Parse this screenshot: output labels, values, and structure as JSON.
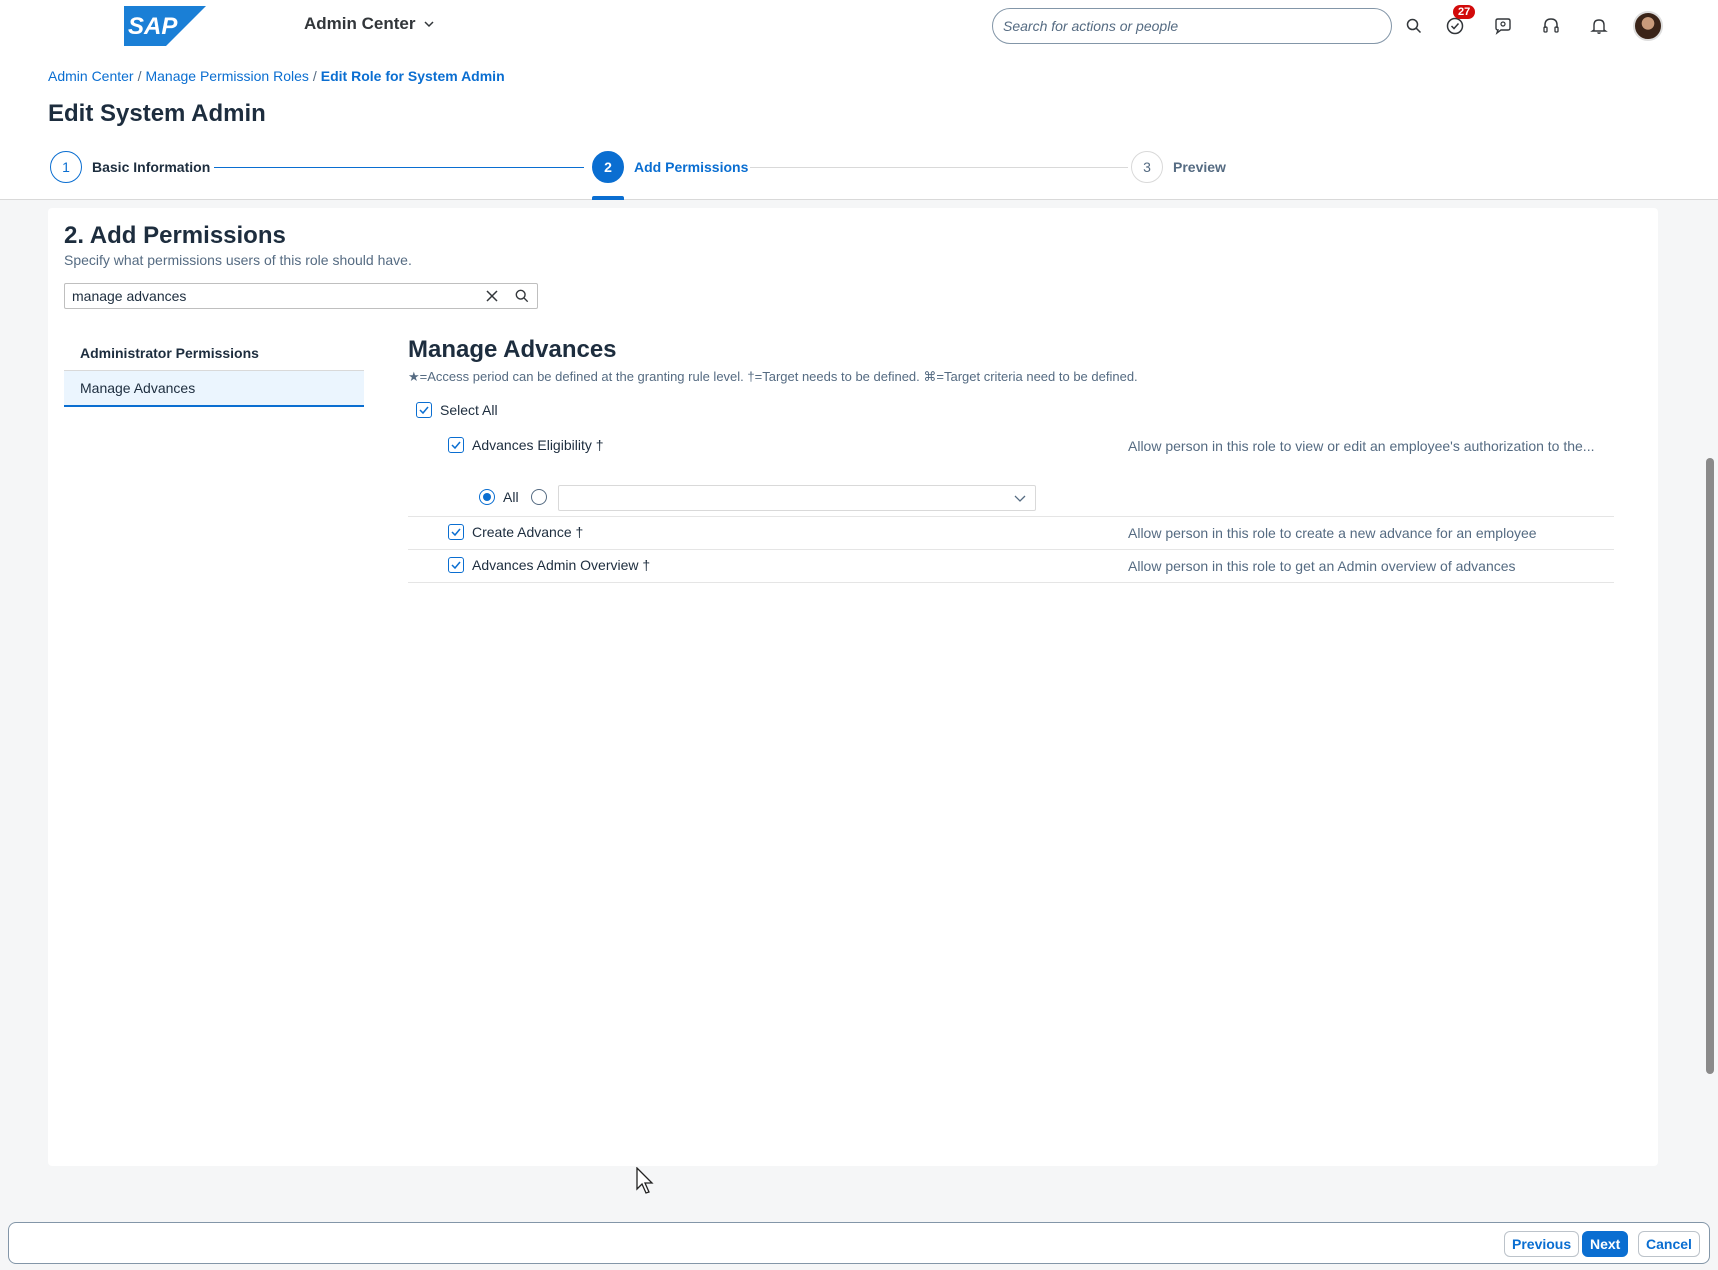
{
  "shell": {
    "logo_text": "SAP",
    "product": "Admin Center",
    "search_placeholder": "Search for actions or people",
    "notification_count": "27",
    "icons": [
      "search-icon",
      "todo-icon",
      "feedback-icon",
      "help-icon",
      "bell-icon",
      "avatar"
    ]
  },
  "breadcrumb": {
    "items": [
      "Admin Center",
      "Manage Permission Roles"
    ],
    "current": "Edit Role for System Admin",
    "separator": "/"
  },
  "page_title": "Edit System Admin",
  "wizard": {
    "steps": [
      {
        "number": "1",
        "label": "Basic Information",
        "state": "completed"
      },
      {
        "number": "2",
        "label": "Add Permissions",
        "state": "active"
      },
      {
        "number": "3",
        "label": "Preview",
        "state": "upcoming"
      }
    ]
  },
  "section": {
    "title": "2. Add Permissions",
    "subtitle": "Specify what permissions users of this role should have.",
    "search_value": "manage advances"
  },
  "left_panel": {
    "header": "Administrator Permissions",
    "selected_item": "Manage Advances"
  },
  "right_panel": {
    "title": "Manage Advances",
    "legend": "★=Access period can be defined at the granting rule level.   †=Target needs to be defined.   ⌘=Target criteria need to be defined.",
    "select_all": "Select All",
    "permissions": [
      {
        "label": "Advances Eligibility †",
        "checked": true,
        "description": "Allow person in this role to view or edit an employee's authorization to the..."
      },
      {
        "label": "Create Advance †",
        "checked": true,
        "description": "Allow person in this role to create a new advance for an employee"
      },
      {
        "label": "Advances Admin Overview †",
        "checked": true,
        "description": "Allow person in this role to get an Admin overview of advances"
      }
    ],
    "target": {
      "all_label": "All",
      "selected": "All",
      "dropdown_value": ""
    }
  },
  "footer": {
    "previous": "Previous",
    "next": "Next",
    "cancel": "Cancel"
  },
  "colors": {
    "accent": "#0a6ed1",
    "badge": "#d20a0a",
    "text": "#1d2d3e",
    "muted": "#556b82"
  }
}
